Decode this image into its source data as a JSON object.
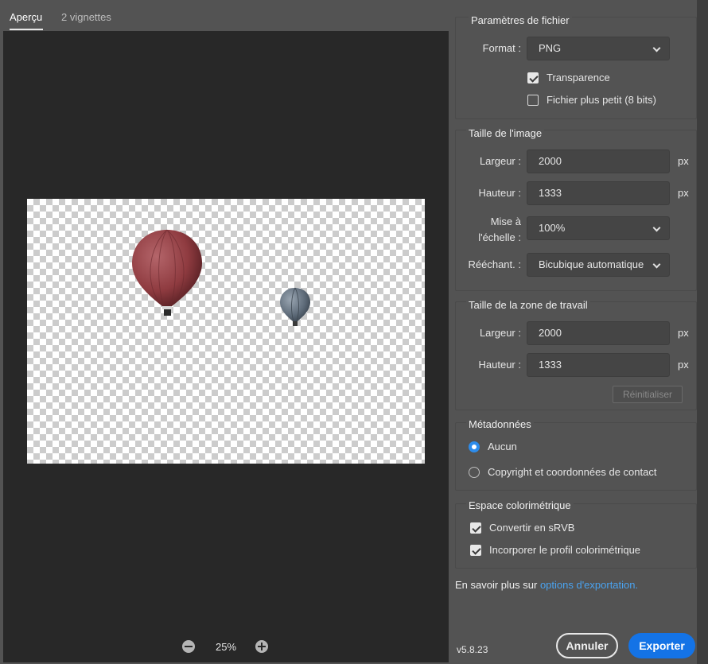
{
  "tabs": [
    {
      "label": "Aperçu",
      "active": true
    },
    {
      "label": "2 vignettes",
      "active": false
    }
  ],
  "preview": {
    "zoom": "25%",
    "balloons": [
      {
        "name": "red-balloon",
        "color": "#8f3b40"
      },
      {
        "name": "gray-balloon",
        "color": "#5d6a78"
      }
    ]
  },
  "file_settings": {
    "title": "Paramètres de fichier",
    "format_label": "Format :",
    "format_value": "PNG",
    "transparency_label": "Transparence",
    "transparency_checked": true,
    "smaller_file_label": "Fichier plus petit (8 bits)",
    "smaller_file_checked": false
  },
  "image_size": {
    "title": "Taille de l'image",
    "width_label": "Largeur :",
    "width_value": "2000",
    "height_label": "Hauteur :",
    "height_value": "1333",
    "unit": "px",
    "scale_label_1": "Mise à",
    "scale_label_2": "l'échelle :",
    "scale_value": "100%",
    "resample_label": "Rééchant. :",
    "resample_value": "Bicubique automatique"
  },
  "canvas_size": {
    "title": "Taille de la zone de travail",
    "width_label": "Largeur :",
    "width_value": "2000",
    "height_label": "Hauteur :",
    "height_value": "1333",
    "unit": "px",
    "reset_label": "Réinitialiser"
  },
  "metadata": {
    "title": "Métadonnées",
    "options": [
      {
        "label": "Aucun",
        "selected": true
      },
      {
        "label": "Copyright et coordonnées de contact",
        "selected": false
      }
    ]
  },
  "color_space": {
    "title": "Espace colorimétrique",
    "convert_label": "Convertir en sRVB",
    "convert_checked": true,
    "embed_label": "Incorporer le profil colorimétrique",
    "embed_checked": true
  },
  "footer": {
    "learn_prefix": "En savoir plus sur ",
    "learn_link": "options d'exportation.",
    "version": "v5.8.23",
    "cancel_label": "Annuler",
    "export_label": "Exporter"
  },
  "colors": {
    "accent": "#1473e6",
    "link": "#4aa3f0",
    "radio_selected": "#2d8ceb"
  }
}
